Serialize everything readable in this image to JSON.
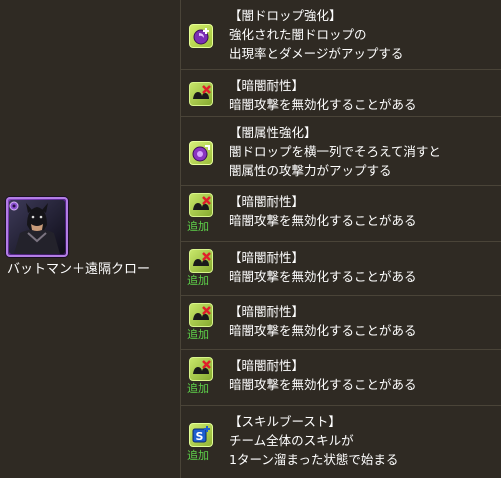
{
  "monster": {
    "name": "バットマン＋遠隔クロー"
  },
  "rows": [
    {
      "icon": "dark-drop-enhance-icon",
      "added": "",
      "title": "【闇ドロップ強化】",
      "lines": [
        "強化された闇ドロップの",
        "出現率とダメージがアップする"
      ]
    },
    {
      "icon": "dark-resist-icon",
      "added": "",
      "title": "【暗闇耐性】",
      "lines": [
        "暗闇攻撃を無効化することがある"
      ]
    },
    {
      "icon": "dark-attribute-enhance-icon",
      "added": "",
      "title": "【闇属性強化】",
      "lines": [
        "闇ドロップを横一列でそろえて消すと",
        "闇属性の攻撃力がアップする"
      ]
    },
    {
      "icon": "dark-resist-icon",
      "added": "追加",
      "title": "【暗闇耐性】",
      "lines": [
        "暗闇攻撃を無効化することがある"
      ]
    },
    {
      "icon": "dark-resist-icon",
      "added": "追加",
      "title": "【暗闇耐性】",
      "lines": [
        "暗闇攻撃を無効化することがある"
      ]
    },
    {
      "icon": "dark-resist-icon",
      "added": "追加",
      "title": "【暗闇耐性】",
      "lines": [
        "暗闇攻撃を無効化することがある"
      ]
    },
    {
      "icon": "dark-resist-icon",
      "added": "追加",
      "title": "【暗闇耐性】",
      "lines": [
        "暗闇攻撃を無効化することがある"
      ]
    },
    {
      "icon": "skill-boost-icon",
      "added": "追加",
      "title": "【スキルブースト】",
      "lines": [
        "チーム全体のスキルが",
        "1ターン溜まった状態で始まる"
      ]
    }
  ],
  "colors": {
    "background": "#2f2a23",
    "divider": "#4a4438",
    "added_tag": "#5ed24a",
    "text": "#ffffff"
  }
}
